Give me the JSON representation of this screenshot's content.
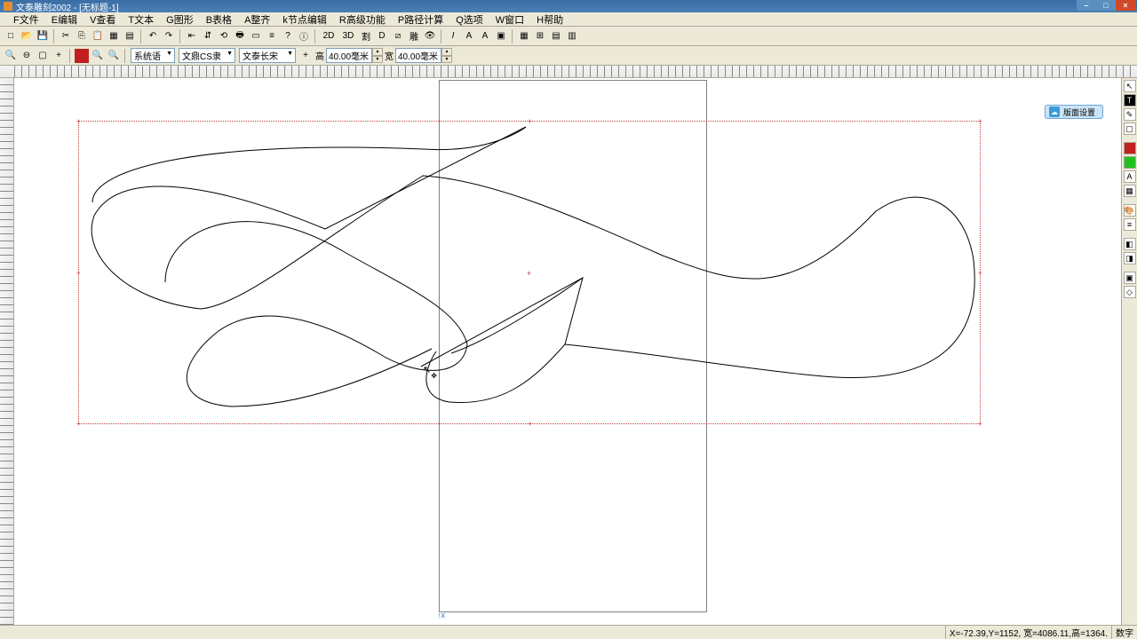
{
  "title": "文泰雕刻2002 - [无标题-1]",
  "menu": {
    "file": "F文件",
    "edit": "E编辑",
    "view": "V查看",
    "text": "T文本",
    "graphic": "G图形",
    "table": "B表格",
    "arrange": "A整齐",
    "node": "k节点编辑",
    "advanced": "R高级功能",
    "path": "P路径计算",
    "options": "Q选项",
    "window": "W窗口",
    "help": "H帮助"
  },
  "toolbar1": {
    "b2d": "2D",
    "b3d": "3D",
    "bTo": "割",
    "bD": "D"
  },
  "toolbar2": {
    "fontDropdown1": "系统语言",
    "fontDropdown2": "文鼎CS隶体",
    "fontDropdown3": "文泰长宋",
    "heightLabel": "高",
    "heightValue": "40.00毫米",
    "widthLabel": "宽",
    "widthValue": "40.00毫米"
  },
  "floatButton": {
    "label": "版面设置"
  },
  "status": {
    "coords": "X=-72.39,Y=1152, 宽=4086.11,高=1364.",
    "right": "数字"
  },
  "origin": "x"
}
